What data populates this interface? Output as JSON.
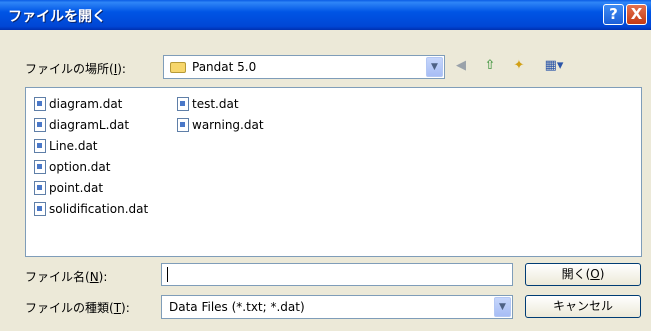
{
  "title": "ファイルを開く",
  "title_buttons": {
    "help": "?",
    "close": "X"
  },
  "location": {
    "label": "ファイルの場所(",
    "accel": "I",
    "label_end": "):",
    "value": "Pandat 5.0"
  },
  "files": [
    "diagram.dat",
    "diagramL.dat",
    "Line.dat",
    "option.dat",
    "point.dat",
    "solidification.dat",
    "test.dat",
    "warning.dat"
  ],
  "filename": {
    "label": "ファイル名(",
    "accel": "N",
    "label_end": "):",
    "value": ""
  },
  "filetype": {
    "label": "ファイルの種類(",
    "accel": "T",
    "label_end": "):",
    "value": "Data Files (*.txt; *.dat)"
  },
  "buttons": {
    "open": "開く(",
    "open_accel": "O",
    "open_end": ")",
    "cancel": "キャンセル"
  },
  "icons": {
    "back": "back-icon",
    "up": "up-folder-icon",
    "new": "new-folder-icon",
    "views": "views-icon"
  }
}
